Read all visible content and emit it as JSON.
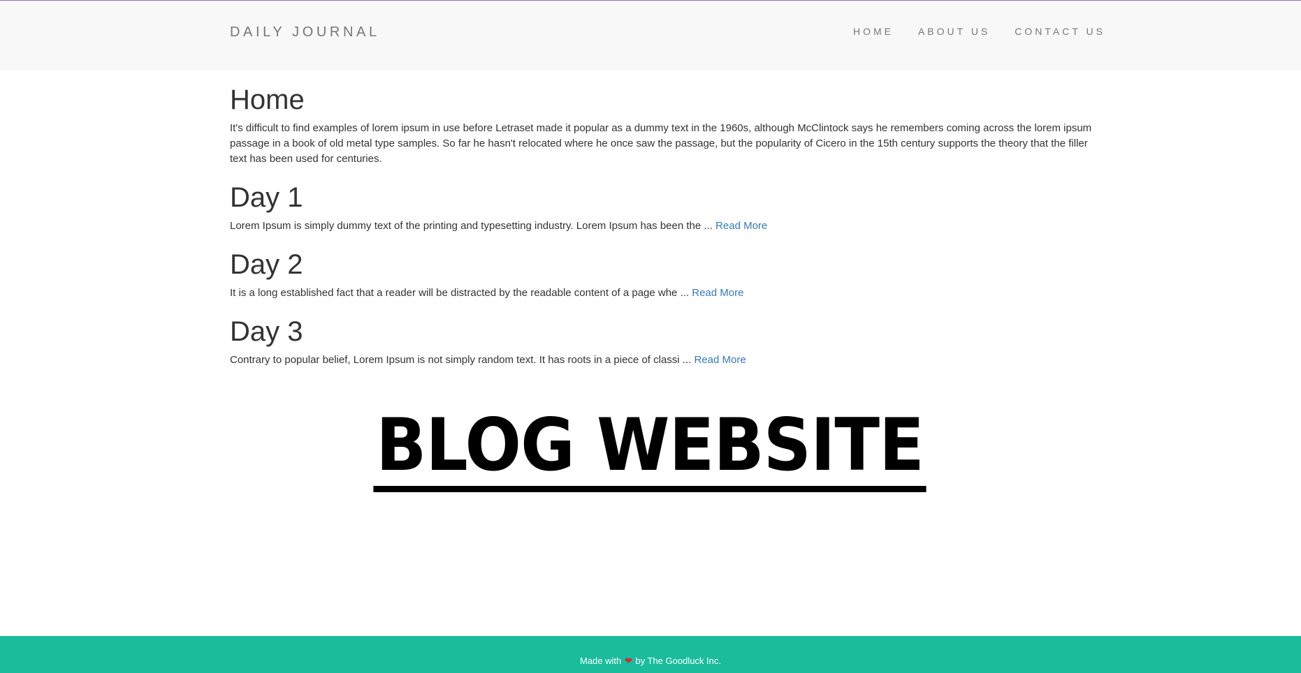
{
  "navbar": {
    "brand": "DAILY JOURNAL",
    "items": [
      {
        "label": "HOME"
      },
      {
        "label": "ABOUT US"
      },
      {
        "label": "CONTACT US"
      }
    ]
  },
  "home": {
    "title": "Home",
    "intro": "It's difficult to find examples of lorem ipsum in use before Letraset made it popular as a dummy text in the 1960s, although McClintock says he remembers coming across the lorem ipsum passage in a book of old metal type samples. So far he hasn't relocated where he once saw the passage, but the popularity of Cicero in the 15th century supports the theory that the filler text has been used for centuries."
  },
  "posts": [
    {
      "title": "Day 1",
      "excerpt": "Lorem Ipsum is simply dummy text of the printing and typesetting industry. Lorem Ipsum has been the ... ",
      "link": "Read More"
    },
    {
      "title": "Day 2",
      "excerpt": "It is a long established fact that a reader will be distracted by the readable content of a page whe ... ",
      "link": "Read More"
    },
    {
      "title": "Day 3",
      "excerpt": "Contrary to popular belief, Lorem Ipsum is not simply random text. It has roots in a piece of classi ... ",
      "link": "Read More"
    }
  ],
  "banner": {
    "text": "BLOG WEBSITE"
  },
  "footer": {
    "prefix": "Made with ",
    "heart_icon": "heart-icon",
    "heart_glyph": "❤",
    "suffix": " by The Goodluck Inc."
  },
  "colors": {
    "navbar_bg": "#f8f8f8",
    "link": "#337ab7",
    "footer_bg": "#1abc9c",
    "heart": "#e0242c"
  }
}
